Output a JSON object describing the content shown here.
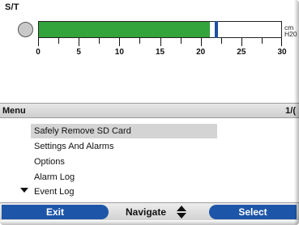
{
  "mode_label": "S/T",
  "pressure_gauge": {
    "value": 21,
    "fill_percent": 70,
    "unit_line1": "cm",
    "unit_line2": "H20",
    "tick_labels": [
      "0",
      "5",
      "10",
      "15",
      "20",
      "25",
      "30"
    ],
    "fill_color": "#33a33c",
    "marker_color": "#1f4fa0"
  },
  "menu": {
    "title": "Menu",
    "page": "1/(",
    "items": [
      {
        "label": "Safely Remove SD Card",
        "selected": true
      },
      {
        "label": "Settings And Alarms",
        "selected": false
      },
      {
        "label": "Options",
        "selected": false
      },
      {
        "label": "Alarm Log",
        "selected": false
      },
      {
        "label": "Event Log",
        "selected": false
      }
    ],
    "more_indicator_icon": "scroll-down-icon"
  },
  "softkeys": {
    "left_label": "Exit",
    "center_label": "Navigate",
    "center_icon": "up-down-arrows-icon",
    "right_label": "Select",
    "accent_color": "#1d56a8"
  }
}
